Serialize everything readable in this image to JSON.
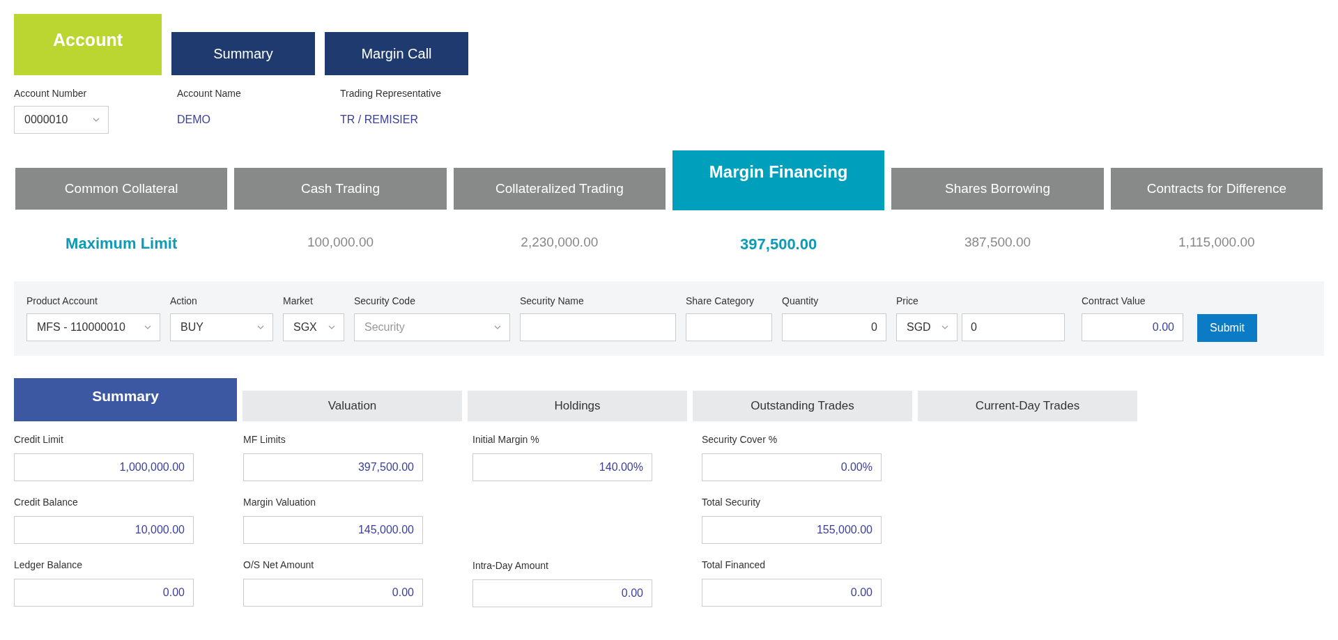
{
  "header_tabs": [
    {
      "label": "Account",
      "selected": true
    },
    {
      "label": "Summary",
      "selected": false
    },
    {
      "label": "Margin Call",
      "selected": false
    }
  ],
  "account_info": [
    {
      "label": "Account Number",
      "kind": "select",
      "value": "0000010"
    },
    {
      "label": "Account Name",
      "kind": "text",
      "value": "DEMO"
    },
    {
      "label": "Trading Representative",
      "kind": "text",
      "value": "TR / REMISIER"
    }
  ],
  "product_tabs": [
    {
      "label": "Common Collateral",
      "selected": false,
      "value": "Maximum Limit",
      "kind": "heading"
    },
    {
      "label": "Cash Trading",
      "selected": false,
      "value": "100,000.00",
      "kind": "amount"
    },
    {
      "label": "Collateralized Trading",
      "selected": false,
      "value": "2,230,000.00",
      "kind": "amount"
    },
    {
      "label": "Margin Financing",
      "selected": true,
      "value": "397,500.00",
      "kind": "amount"
    },
    {
      "label": "Shares Borrowing",
      "selected": false,
      "value": "387,500.00",
      "kind": "amount"
    },
    {
      "label": "Contracts for Difference",
      "selected": false,
      "value": "1,115,000.00",
      "kind": "amount"
    }
  ],
  "order_form": {
    "fields": [
      {
        "label": "Product Account",
        "controls": [
          {
            "kind": "select",
            "value": "MFS - 110000010"
          }
        ]
      },
      {
        "label": "Action",
        "controls": [
          {
            "kind": "select",
            "value": "BUY"
          }
        ]
      },
      {
        "label": "Market",
        "controls": [
          {
            "kind": "select",
            "value": "SGX"
          }
        ]
      },
      {
        "label": "Security Code",
        "controls": [
          {
            "kind": "select",
            "placeholder": "Security"
          }
        ]
      },
      {
        "label": "Security Name",
        "controls": [
          {
            "kind": "text"
          }
        ]
      },
      {
        "label": "Share Category",
        "controls": [
          {
            "kind": "text"
          }
        ]
      },
      {
        "label": "Quantity",
        "controls": [
          {
            "kind": "number",
            "value": "0"
          }
        ]
      },
      {
        "label": "Price",
        "controls": [
          {
            "kind": "select",
            "value": "SGD"
          },
          {
            "kind": "text",
            "value": "0"
          }
        ]
      },
      {
        "label": "Contract Value",
        "controls": [
          {
            "kind": "amount",
            "value": "0.00"
          }
        ]
      }
    ],
    "submit": "Submit"
  },
  "detail_tabs": [
    {
      "label": "Summary",
      "selected": true
    },
    {
      "label": "Valuation",
      "selected": false
    },
    {
      "label": "Holdings",
      "selected": false
    },
    {
      "label": "Outstanding Trades",
      "selected": false
    },
    {
      "label": "Current-Day Trades",
      "selected": false
    }
  ],
  "summary_columns": [
    [
      {
        "label": "Credit Limit",
        "value": "1,000,000.00"
      },
      {
        "label": "Credit Balance",
        "value": "10,000.00"
      },
      {
        "label": "Ledger Balance",
        "value": "0.00"
      }
    ],
    [
      {
        "label": "MF Limits",
        "value": "397,500.00"
      },
      {
        "label": "Margin Valuation",
        "value": "145,000.00"
      },
      {
        "label": "O/S Net Amount",
        "value": "0.00"
      }
    ],
    [
      {
        "label": "Initial Margin %",
        "value": "140.00%"
      },
      {
        "label": "Intra-Day Amount",
        "value": "0.00",
        "gap_before": true
      }
    ],
    [
      {
        "label": "Security Cover %",
        "value": "0.00%"
      },
      {
        "label": "Total Security",
        "value": "155,000.00"
      },
      {
        "label": "Total Financed",
        "value": "0.00"
      }
    ]
  ]
}
